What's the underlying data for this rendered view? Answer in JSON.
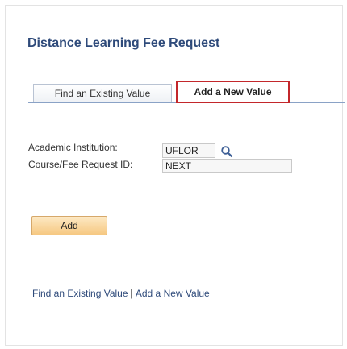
{
  "page": {
    "title": "Distance Learning Fee Request"
  },
  "tabs": {
    "find_existing": {
      "label_accesskey": "F",
      "label_rest": "ind an Existing Value"
    },
    "add_new": {
      "label": "Add a New Value"
    }
  },
  "form": {
    "institution": {
      "label": "Academic Institution:",
      "value": "UFLOR"
    },
    "request_id": {
      "label": "Course/Fee Request ID:",
      "value": "NEXT"
    }
  },
  "buttons": {
    "add_label": "Add"
  },
  "footer_links": {
    "find_existing": "Find an Existing Value",
    "separator": "|",
    "add_new": "Add a New Value"
  },
  "colors": {
    "title": "#2e4a7a",
    "active_tab_border": "#c3272b",
    "button_fill": "#f6c881"
  },
  "icons": {
    "lookup": "magnifier-icon"
  }
}
